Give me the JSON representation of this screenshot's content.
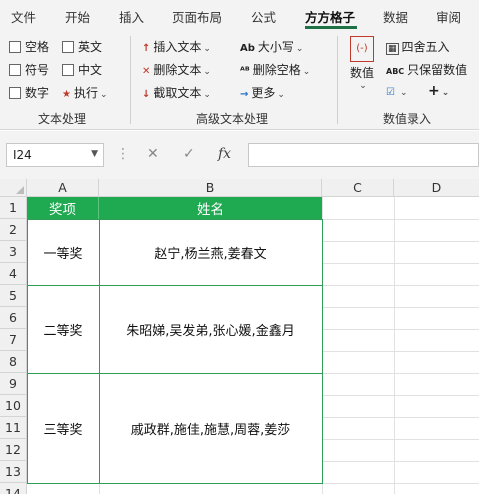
{
  "ribbon_tabs": [
    "文件",
    "开始",
    "插入",
    "页面布局",
    "公式",
    "方方格子",
    "数据",
    "审阅"
  ],
  "active_tab": "方方格子",
  "text_processing": {
    "checkboxes": [
      "空格",
      "英文",
      "符号",
      "中文",
      "数字"
    ],
    "execute_label": "执行",
    "group_label": "文本处理"
  },
  "advanced_text": {
    "insert_text": "插入文本",
    "delete_text": "删除文本",
    "extract_text": "截取文本",
    "case": "大小写",
    "delete_space": "删除空格",
    "more": "更多",
    "group_label": "高级文本处理"
  },
  "data_entry": {
    "values": "数值",
    "round": "四舍五入",
    "keep_values": "只保留数值",
    "abc_prefix": "ABC",
    "group_label": "数值录入"
  },
  "formula_bar": {
    "name_box": "I24",
    "fx": "fx",
    "formula": ""
  },
  "columns": [
    "A",
    "B",
    "C",
    "D"
  ],
  "rows": [
    "1",
    "2",
    "3",
    "4",
    "5",
    "6",
    "7",
    "8",
    "9",
    "10",
    "11",
    "12",
    "13",
    "14"
  ],
  "table": {
    "header": [
      "奖项",
      "姓名"
    ],
    "groups": [
      {
        "award": "一等奖",
        "names": "赵宁,杨兰燕,姜春文"
      },
      {
        "award": "二等奖",
        "names": "朱昭娣,吴发弟,张心媛,金鑫月"
      },
      {
        "award": "三等奖",
        "names": "戚政群,施佳,施慧,周蓉,姜莎"
      }
    ]
  },
  "colors": {
    "header_fill": "#1faa52",
    "table_border": "#2e9e57",
    "accent": "#1e7145"
  }
}
